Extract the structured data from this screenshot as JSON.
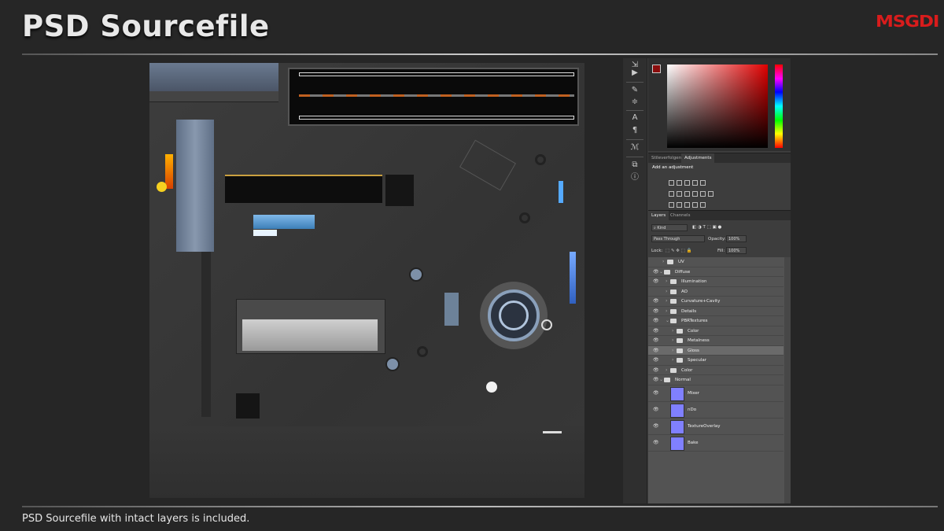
{
  "slide": {
    "title": "PSD Sourcefile",
    "brand_logo": "MSGDI",
    "caption": "PSD Sourcefile with intact layers is included.",
    "accent_color": "#d81c1c"
  },
  "photoshop": {
    "toolbar_icons": [
      "move-icon",
      "brush-icon",
      "adjust-icon",
      "type-icon",
      "paragraph-icon",
      "glyph-icon",
      "layers-icon",
      "info-icon"
    ],
    "color_picker": {
      "foreground": "#8a0d0d",
      "background": "#e8a020"
    },
    "adjustments_panel": {
      "tabs": [
        "Stileverfolgen",
        "Adjustments"
      ],
      "heading": "Add an adjustment"
    },
    "layers_panel": {
      "tabs": [
        "Layers",
        "Channels"
      ],
      "kind_filter": "Kind",
      "blend_mode": "Pass Through",
      "opacity_label": "Opacity:",
      "opacity_value": "100%",
      "lock_label": "Lock:",
      "fill_label": "Fill:",
      "fill_value": "100%",
      "layers": [
        {
          "name": "UV",
          "type": "folder",
          "indent": 1,
          "visible": false
        },
        {
          "name": "Diffuse",
          "type": "folder",
          "indent": 0,
          "visible": true,
          "expanded": true
        },
        {
          "name": "Illumination",
          "type": "folder",
          "indent": 1,
          "visible": true
        },
        {
          "name": "AO",
          "type": "folder",
          "indent": 1,
          "visible": false
        },
        {
          "name": "Curvature+Cavity",
          "type": "folder",
          "indent": 1,
          "visible": true
        },
        {
          "name": "Details",
          "type": "folder",
          "indent": 1,
          "visible": true
        },
        {
          "name": "PBRTextures",
          "type": "folder",
          "indent": 1,
          "visible": true,
          "expanded": true
        },
        {
          "name": "Color",
          "type": "folder",
          "indent": 2,
          "visible": true
        },
        {
          "name": "Metalness",
          "type": "folder",
          "indent": 2,
          "visible": true
        },
        {
          "name": "Gloss",
          "type": "folder",
          "indent": 2,
          "visible": true,
          "selected": true
        },
        {
          "name": "Specular",
          "type": "folder",
          "indent": 2,
          "visible": true
        },
        {
          "name": "Color",
          "type": "folder",
          "indent": 1,
          "visible": true
        },
        {
          "name": "Normal",
          "type": "folder",
          "indent": 0,
          "visible": true,
          "expanded": true
        },
        {
          "name": "Mixer",
          "type": "layer",
          "visible": true
        },
        {
          "name": "nDo",
          "type": "layer",
          "visible": true
        },
        {
          "name": "TextureOverlay",
          "type": "layer",
          "visible": true
        },
        {
          "name": "Bake",
          "type": "layer",
          "visible": true
        }
      ]
    }
  }
}
